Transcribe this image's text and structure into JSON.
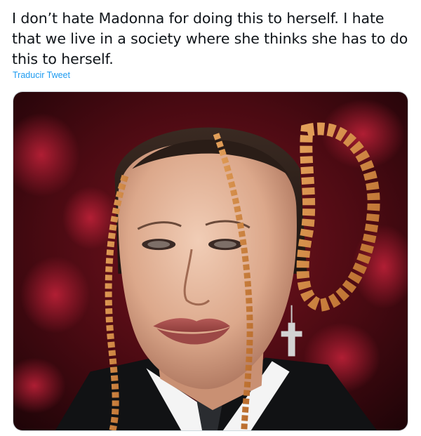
{
  "tweet": {
    "text": "I don’t hate Madonna for doing this to herself. I hate that we live in a society where she thinks she has to do this to herself.",
    "translate_label": "Traducir Tweet"
  },
  "colors": {
    "link": "#1d9bf0",
    "text": "#0f1419",
    "photo_background": "#5a0d14"
  }
}
